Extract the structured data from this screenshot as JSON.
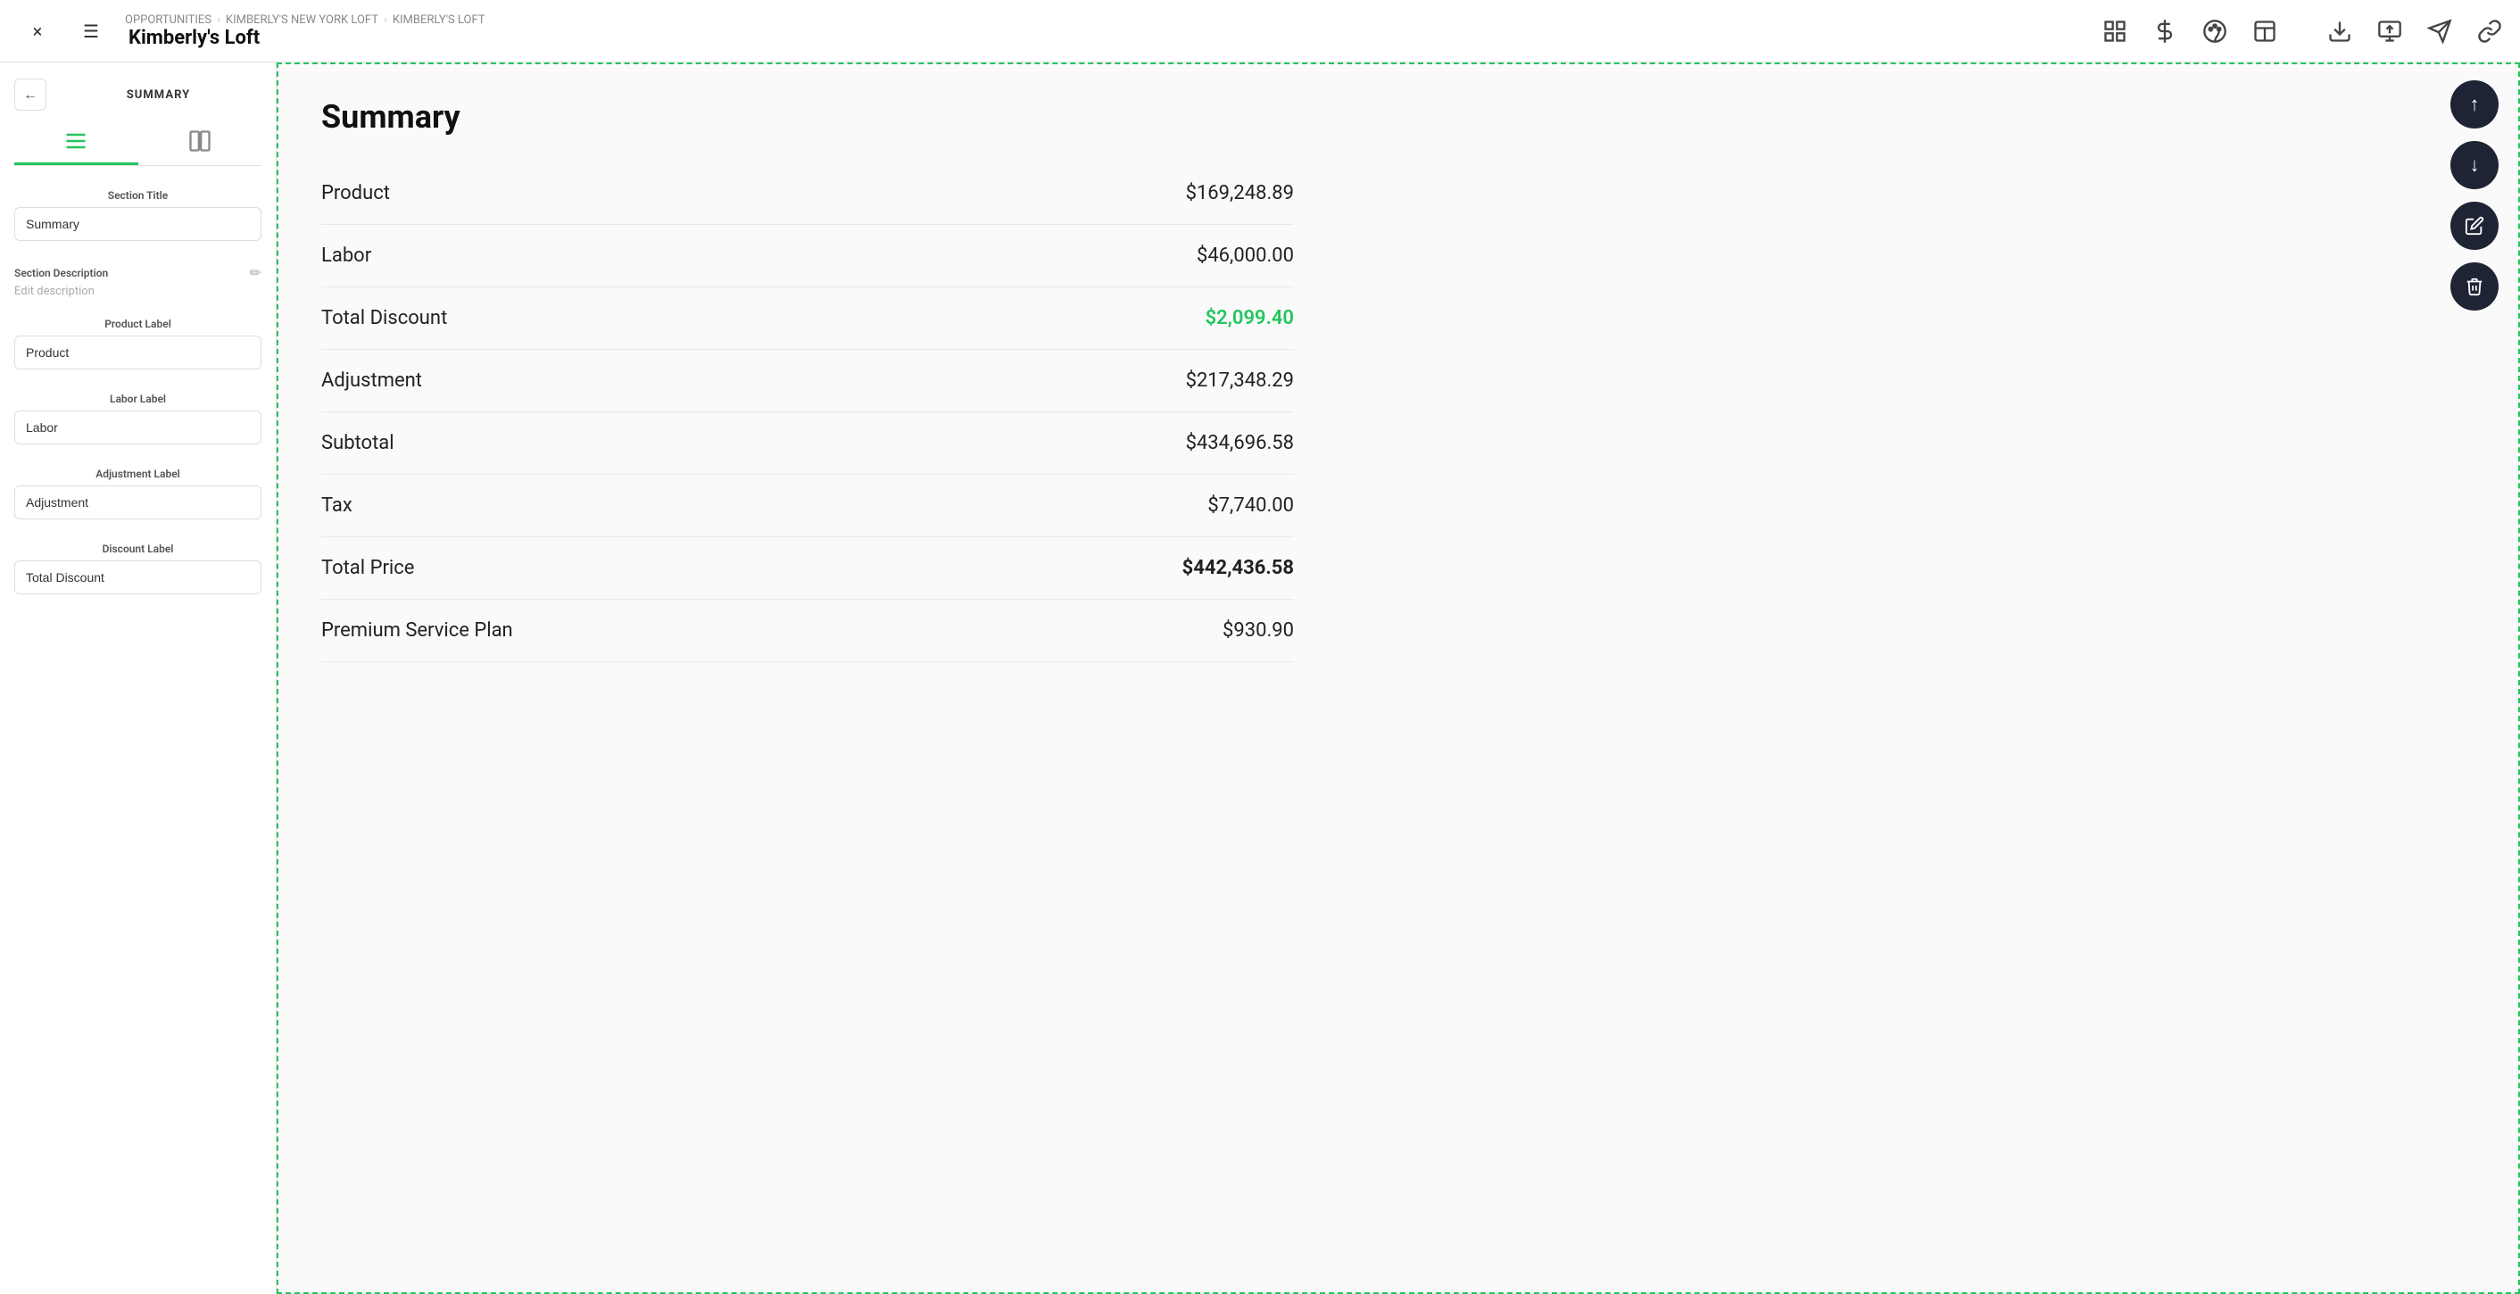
{
  "topbar": {
    "close_label": "×",
    "menu_label": "☰",
    "breadcrumb": {
      "part1": "OPPORTUNITIES",
      "sep1": "›",
      "part2": "KIMBERLY'S NEW YORK LOFT",
      "sep2": "›",
      "part3": "KIMBERLY'S LOFT"
    },
    "title": "Kimberly's Loft",
    "icons": {
      "grid": "⊞",
      "dollar": "$",
      "palette": "🎨",
      "layout": "⬜"
    },
    "right_icons": {
      "download": "⬇",
      "monitor": "⬆",
      "send": "✈",
      "link": "🔗"
    }
  },
  "left_panel": {
    "title": "SUMMARY",
    "back_icon": "←",
    "view_toggle": {
      "list_icon": "☰",
      "split_icon": "⊞"
    },
    "section_title_label": "Section Title",
    "section_title_value": "Summary",
    "section_description_label": "Section Description",
    "edit_description_text": "Edit description",
    "product_label_label": "Product Label",
    "product_label_value": "Product",
    "labor_label_label": "Labor Label",
    "labor_label_value": "Labor",
    "adjustment_label_label": "Adjustment Label",
    "adjustment_label_value": "Adjustment",
    "discount_label_label": "Discount Label",
    "discount_label_value": "Total Discount"
  },
  "summary": {
    "heading": "Summary",
    "rows": [
      {
        "label": "Product",
        "value": "$169,248.89",
        "discount": false
      },
      {
        "label": "Labor",
        "value": "$46,000.00",
        "discount": false
      },
      {
        "label": "Total Discount",
        "value": "$2,099.40",
        "discount": true
      },
      {
        "label": "Adjustment",
        "value": "$217,348.29",
        "discount": false
      },
      {
        "label": "Subtotal",
        "value": "$434,696.58",
        "discount": false
      },
      {
        "label": "Tax",
        "value": "$7,740.00",
        "discount": false
      },
      {
        "label": "Total Price",
        "value": "$442,436.58",
        "discount": false
      },
      {
        "label": "Premium Service Plan",
        "value": "$930.90",
        "discount": false
      }
    ]
  },
  "floating_buttons": {
    "up_icon": "↑",
    "down_icon": "↓",
    "edit_icon": "✏",
    "delete_icon": "🗑"
  }
}
